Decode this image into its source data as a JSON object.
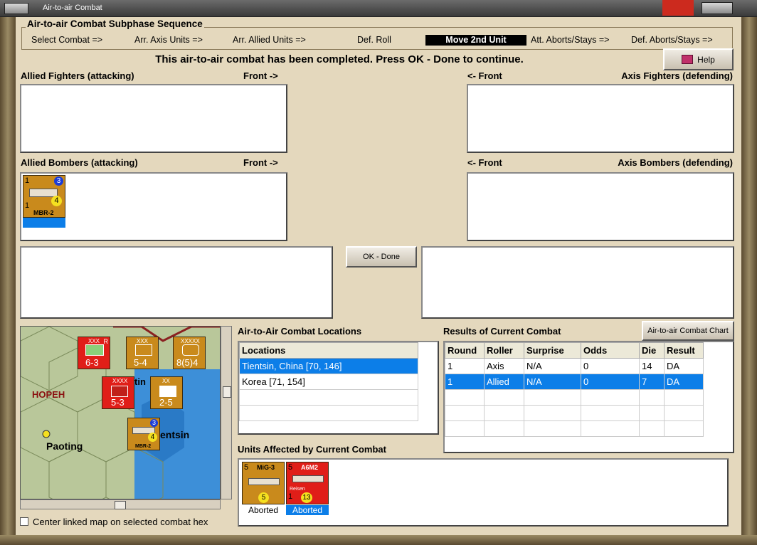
{
  "window": {
    "title": "Air-to-air Combat"
  },
  "subphase": {
    "title": "Air-to-air Combat Subphase Sequence",
    "steps": [
      "Select Combat =>",
      "Arr. Axis Units =>",
      "Arr. Allied Units =>",
      "Def. Roll",
      "Move 2nd Unit",
      "Att. Aborts/Stays =>",
      "Def. Aborts/Stays =>"
    ],
    "active_step": "Move 2nd Unit"
  },
  "status_message": "This air-to-air combat has been completed.  Press OK - Done to continue.",
  "help_label": "Help",
  "panels": {
    "allied_fighters": "Allied Fighters (attacking)",
    "axis_fighters": "Axis Fighters (defending)",
    "allied_bombers": "Allied Bombers (attacking)",
    "axis_bombers": "Axis Bombers (defending)",
    "front_right": "Front ->",
    "front_left": "<- Front"
  },
  "allied_bomber_unit": {
    "name": "MBR-2",
    "top_left": "1",
    "bottom_left": "1",
    "range": "3",
    "strength": "4"
  },
  "ok_button": "OK - Done",
  "locations": {
    "title": "Air-to-Air Combat Locations",
    "header": "Locations",
    "rows": [
      "Tientsin, China [70, 146]",
      "Korea [71, 154]"
    ],
    "selected_index": 0
  },
  "results": {
    "title": "Results of Current Combat",
    "chart_button": "Air-to-air Combat Chart",
    "columns": [
      "Round",
      "Roller",
      "Surprise",
      "Odds",
      "Die",
      "Result"
    ],
    "rows": [
      [
        "1",
        "Axis",
        "N/A",
        "0",
        "14",
        "DA"
      ],
      [
        "1",
        "Allied",
        "N/A",
        "0",
        "7",
        "DA"
      ]
    ],
    "selected_index": 1
  },
  "units_affected": {
    "title": "Units Affected by Current Combat",
    "units": [
      {
        "name": "MiG-3",
        "top_left": "5",
        "strength": "5",
        "status": "Aborted",
        "color": "#c98a1c"
      },
      {
        "name": "A6M2",
        "top_left": "5",
        "strength": "13",
        "tag": "Reisen",
        "bottom_left": "1",
        "status": "Aborted",
        "color": "#e01e18"
      }
    ]
  },
  "map": {
    "labels": {
      "region": "HOPEH",
      "city1": "Paoting",
      "city2": "entsin",
      "city3": "tin"
    },
    "units": [
      {
        "top": "XXX",
        "value": "6-3",
        "corner": "R"
      },
      {
        "top": "XXX",
        "value": "5-4"
      },
      {
        "top": "XXXXX",
        "value": "8(5)4"
      },
      {
        "top": "XXXX",
        "value": "5-3",
        "stack": "2"
      },
      {
        "top": "XX",
        "value": "2-5",
        "stack": "2"
      },
      {
        "name": "MBR-2",
        "range": "3",
        "strength": "4",
        "stack": "3"
      }
    ]
  },
  "center_checkbox_label": "Center linked map on selected combat hex"
}
